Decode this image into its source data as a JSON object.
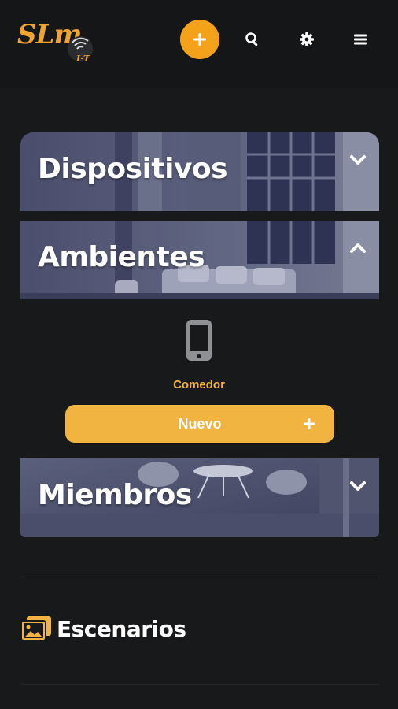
{
  "header": {
    "logo_text": "SLm",
    "logo_badge": "I·T",
    "add_icon": "plus-icon",
    "search_icon": "search-icon",
    "settings_icon": "gear-icon",
    "menu_icon": "hamburger-menu-icon",
    "accent_color": "#f5a21b"
  },
  "sections": [
    {
      "title": "Dispositivos",
      "expanded": false,
      "chevron": "chevron-down-icon"
    },
    {
      "title": "Ambientes",
      "expanded": true,
      "chevron": "chevron-up-icon"
    },
    {
      "title": "Miembros",
      "expanded": false,
      "chevron": "chevron-down-icon"
    }
  ],
  "ambientes": {
    "items": [
      {
        "label": "Comedor",
        "icon": "mobile-phone-icon"
      }
    ],
    "new_button_label": "Nuevo",
    "new_button_icon": "plus-icon"
  },
  "escenarios": {
    "title": "Escenarios",
    "icon": "images-icon"
  }
}
